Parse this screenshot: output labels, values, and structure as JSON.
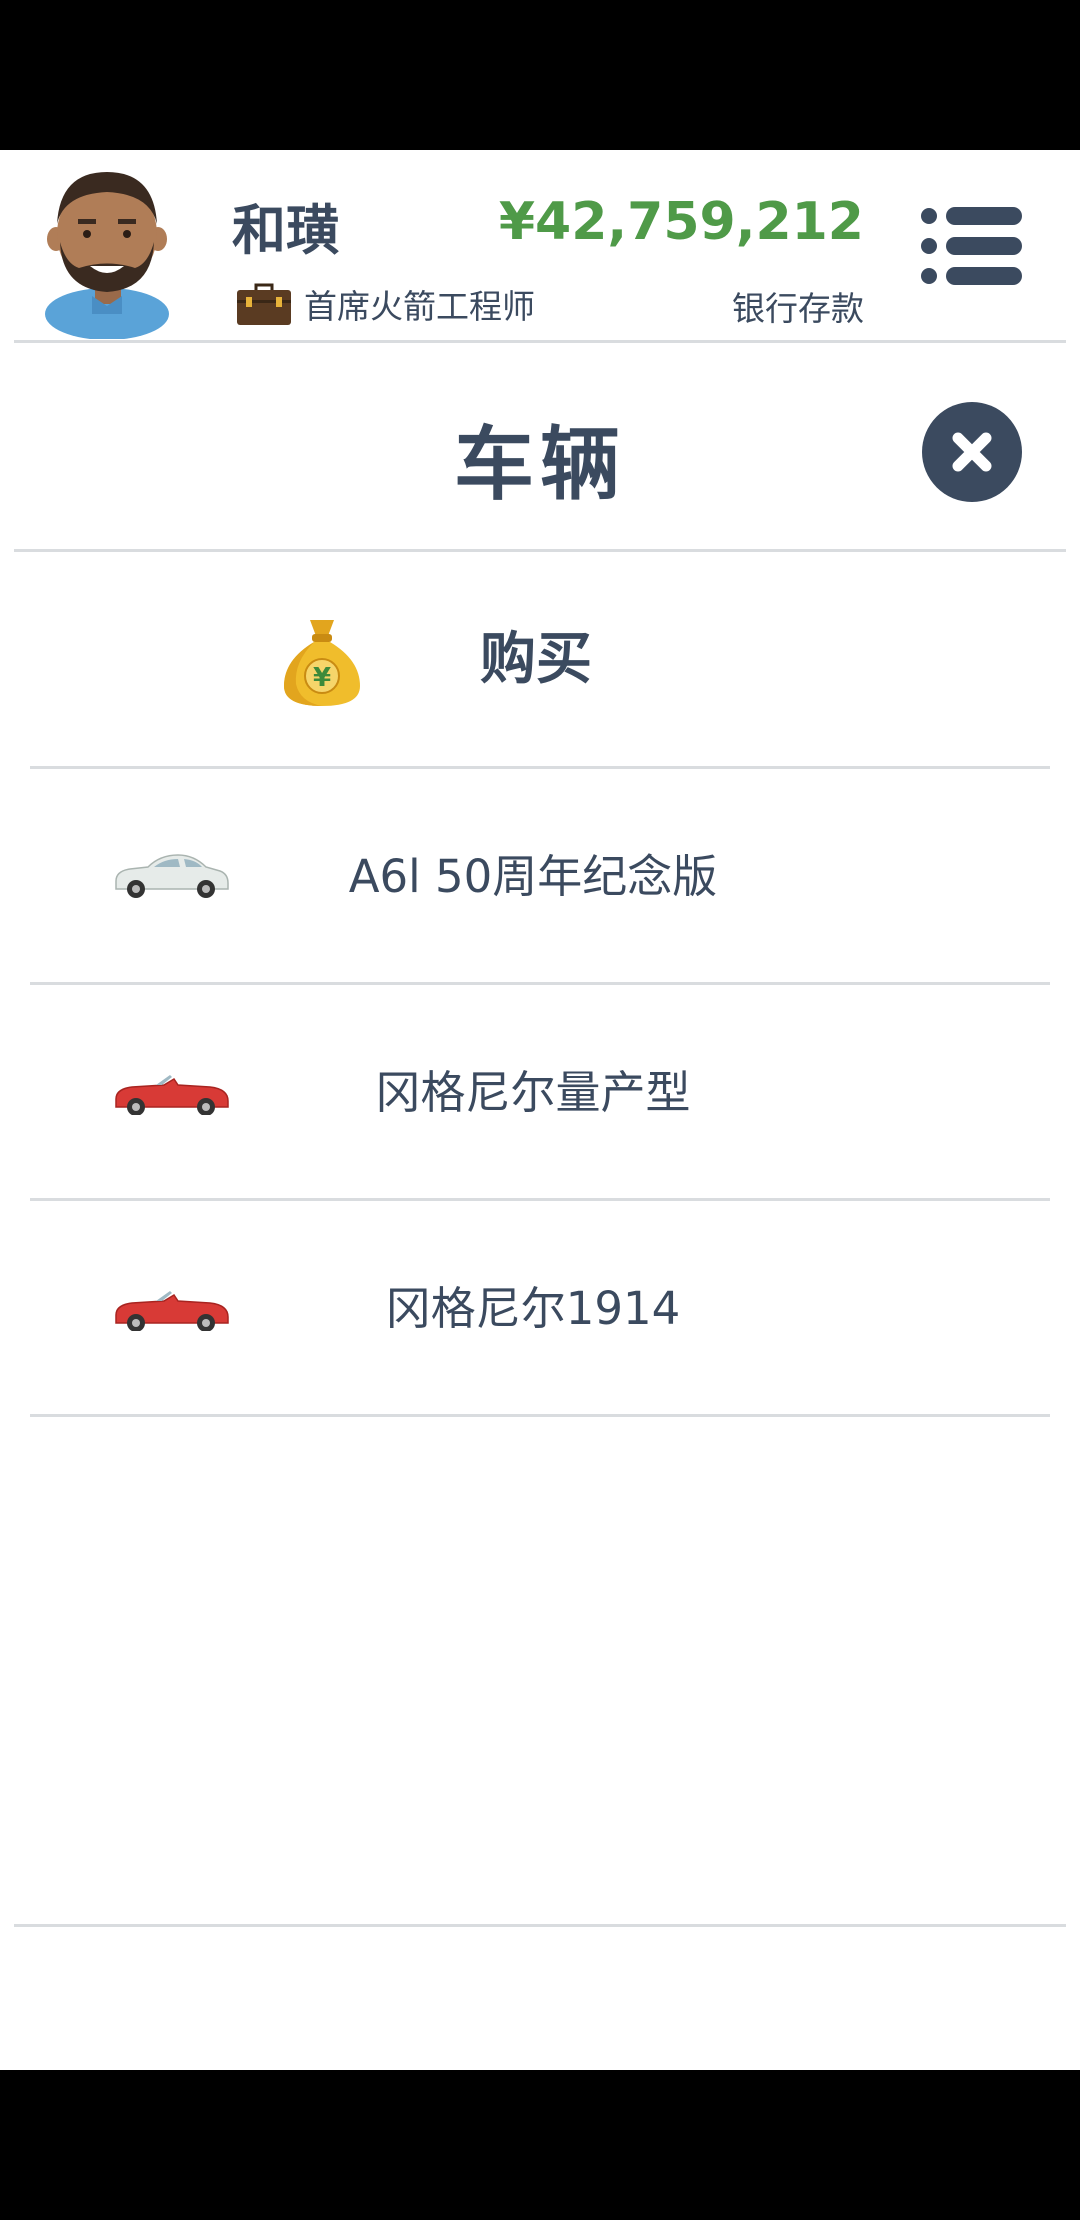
{
  "player": {
    "name": "和璜",
    "job_title": "首席火箭工程师",
    "money": "¥42,759,212",
    "money_label": "银行存款"
  },
  "page": {
    "title": "车辆"
  },
  "buy": {
    "label": "购买"
  },
  "vehicles": [
    {
      "name": "A6l 50周年纪念版",
      "icon": "white-sedan-icon",
      "color": "#e6ebe9"
    },
    {
      "name": "冈格尼尔量产型",
      "icon": "red-convertible-icon",
      "color": "#d83a36"
    },
    {
      "name": "冈格尼尔1914",
      "icon": "red-convertible-icon",
      "color": "#d83a36"
    }
  ],
  "colors": {
    "text": "#3b4a5f",
    "money": "#4f9a48",
    "divider": "#d9dcdf"
  }
}
